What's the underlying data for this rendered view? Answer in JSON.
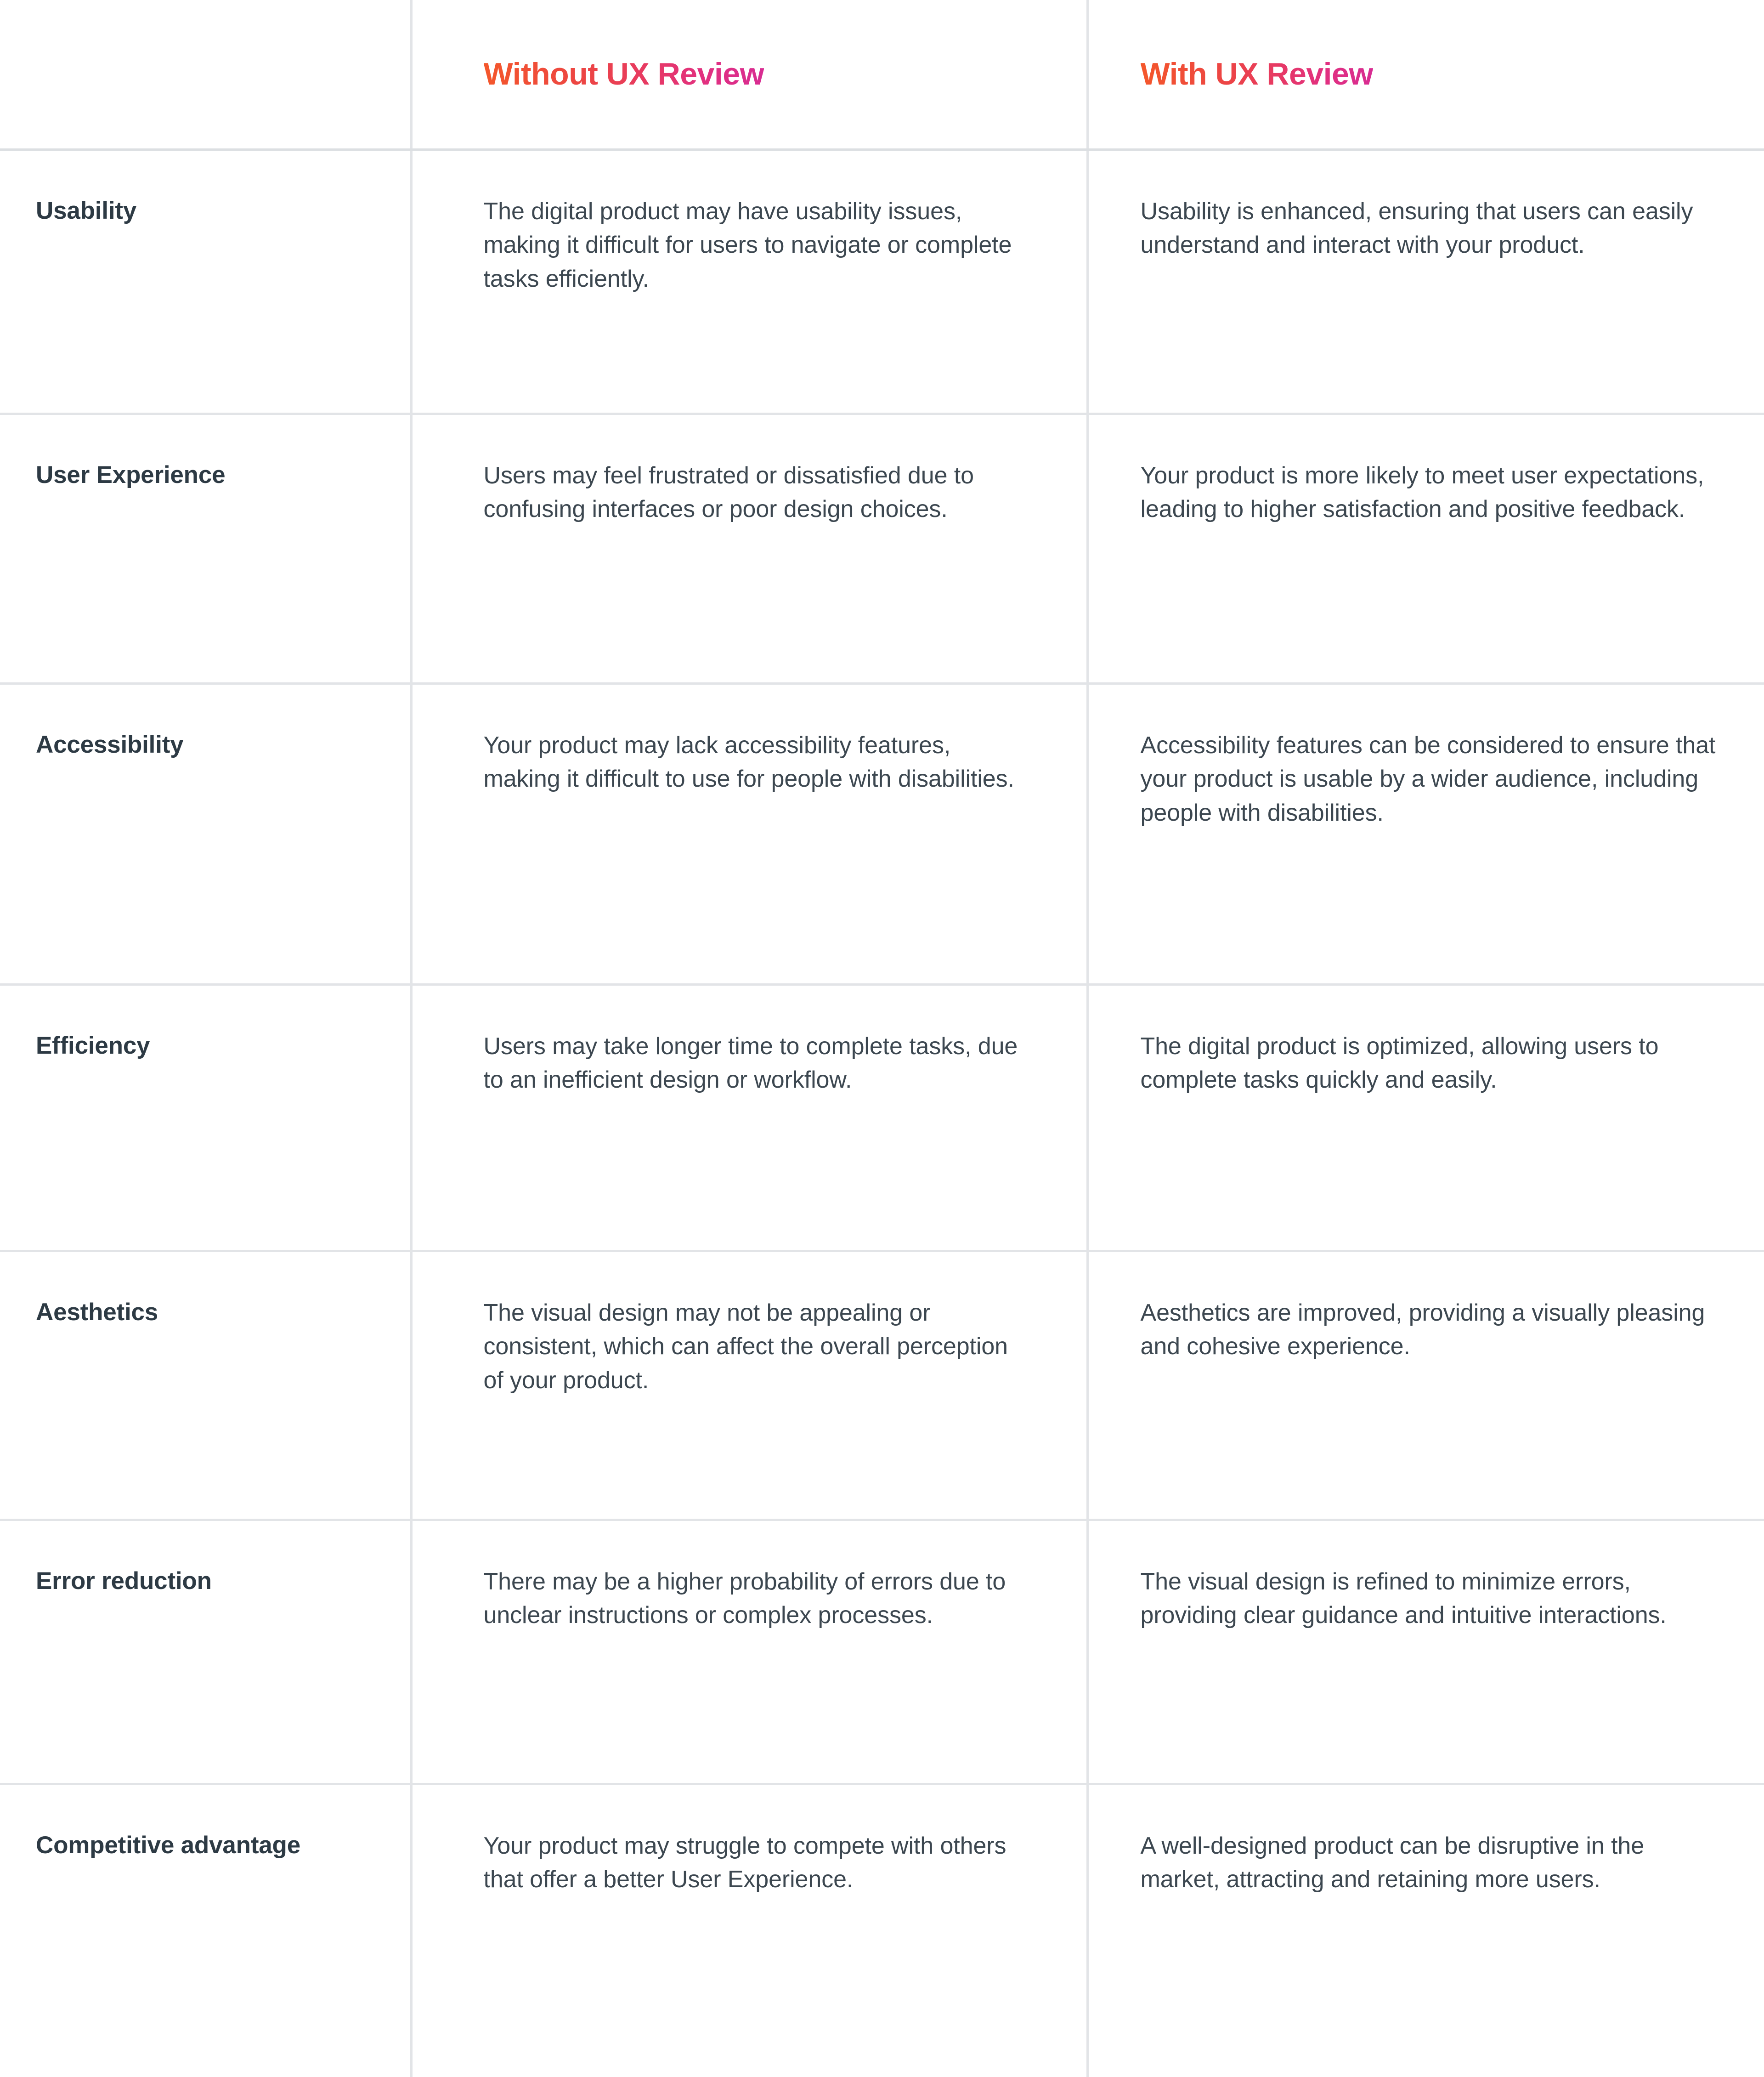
{
  "table": {
    "columns": [
      {
        "key": "feature",
        "header": ""
      },
      {
        "key": "without",
        "header": "Without UX Review"
      },
      {
        "key": "with",
        "header": "With UX Review"
      }
    ],
    "header": {
      "blank": "",
      "without_label": "Without UX Review",
      "with_label": "With UX Review"
    },
    "colors": {
      "gradient_start": "#F4572B",
      "gradient_end": "#D82C92",
      "border": "#E2E4E7",
      "header_border": "#DCDFE2",
      "label_text": "#2D3A44",
      "body_text": "#3C4750",
      "background": "#FFFFFF"
    },
    "rows": [
      {
        "feature": "Usability",
        "without": "The digital product may have usability issues, making it difficult for users to navigate or complete tasks efficiently.",
        "with": "Usability is enhanced, ensuring that users can easily understand and interact with your product."
      },
      {
        "feature": "User Experience",
        "without": "Users may feel frustrated or dissatisfied due to confusing interfaces or poor design choices.",
        "with": "Your product is more likely to meet user expectations, leading to higher satisfaction and positive feedback."
      },
      {
        "feature": "Accessibility",
        "without": "Your product may lack accessibility features, making it difficult to use for people with disabilities.",
        "with": "Accessibility features can be considered to ensure that your product is usable by a wider audience, including people with disabilities."
      },
      {
        "feature": "Efficiency",
        "without": "Users may take longer time to complete tasks, due to an inefficient design or workflow.",
        "with": "The digital product is optimized, allowing users to complete tasks quickly and easily."
      },
      {
        "feature": "Aesthetics",
        "without": "The visual design may not be appealing or consistent, which can affect the overall perception of your product.",
        "with": "Aesthetics are improved, providing a visually pleasing and cohesive experience."
      },
      {
        "feature": "Error reduction",
        "without": "There may be a higher probability of errors due to unclear instructions or complex processes.",
        "with": "The visual design is refined to minimize errors, providing clear guidance and intuitive interactions."
      },
      {
        "feature": "Competitive advantage",
        "without": "Your product may struggle to compete with others that offer a better User Experience.",
        "with": "A well-designed product can be disruptive in the market, attracting and retaining more users."
      }
    ]
  }
}
